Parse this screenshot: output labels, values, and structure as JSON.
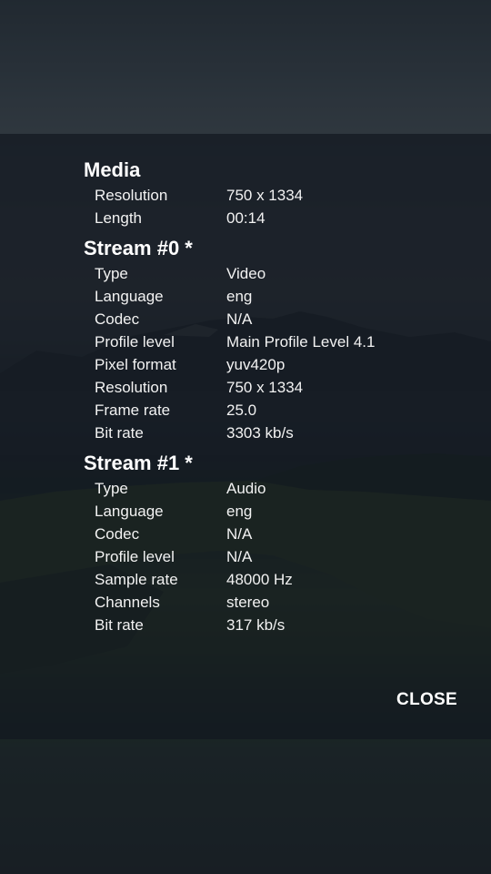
{
  "dialog": {
    "sections": [
      {
        "title": "Media",
        "rows": [
          {
            "label": "Resolution",
            "value": "750 x 1334"
          },
          {
            "label": "Length",
            "value": "00:14"
          }
        ]
      },
      {
        "title": "Stream #0 *",
        "rows": [
          {
            "label": "Type",
            "value": "Video"
          },
          {
            "label": "Language",
            "value": "eng"
          },
          {
            "label": "Codec",
            "value": "N/A"
          },
          {
            "label": "Profile level",
            "value": "Main Profile Level 4.1"
          },
          {
            "label": "Pixel format",
            "value": "yuv420p"
          },
          {
            "label": "Resolution",
            "value": "750 x 1334"
          },
          {
            "label": "Frame rate",
            "value": "25.0"
          },
          {
            "label": "Bit rate",
            "value": "3303 kb/s"
          }
        ]
      },
      {
        "title": "Stream #1 *",
        "rows": [
          {
            "label": "Type",
            "value": "Audio"
          },
          {
            "label": "Language",
            "value": "eng"
          },
          {
            "label": "Codec",
            "value": "N/A"
          },
          {
            "label": "Profile level",
            "value": "N/A"
          },
          {
            "label": "Sample rate",
            "value": "48000 Hz"
          },
          {
            "label": "Channels",
            "value": "stereo"
          },
          {
            "label": "Bit rate",
            "value": "317 kb/s"
          }
        ]
      }
    ],
    "close_label": "CLOSE"
  },
  "colors": {
    "text": "#ffffff",
    "panel": "#121820"
  }
}
